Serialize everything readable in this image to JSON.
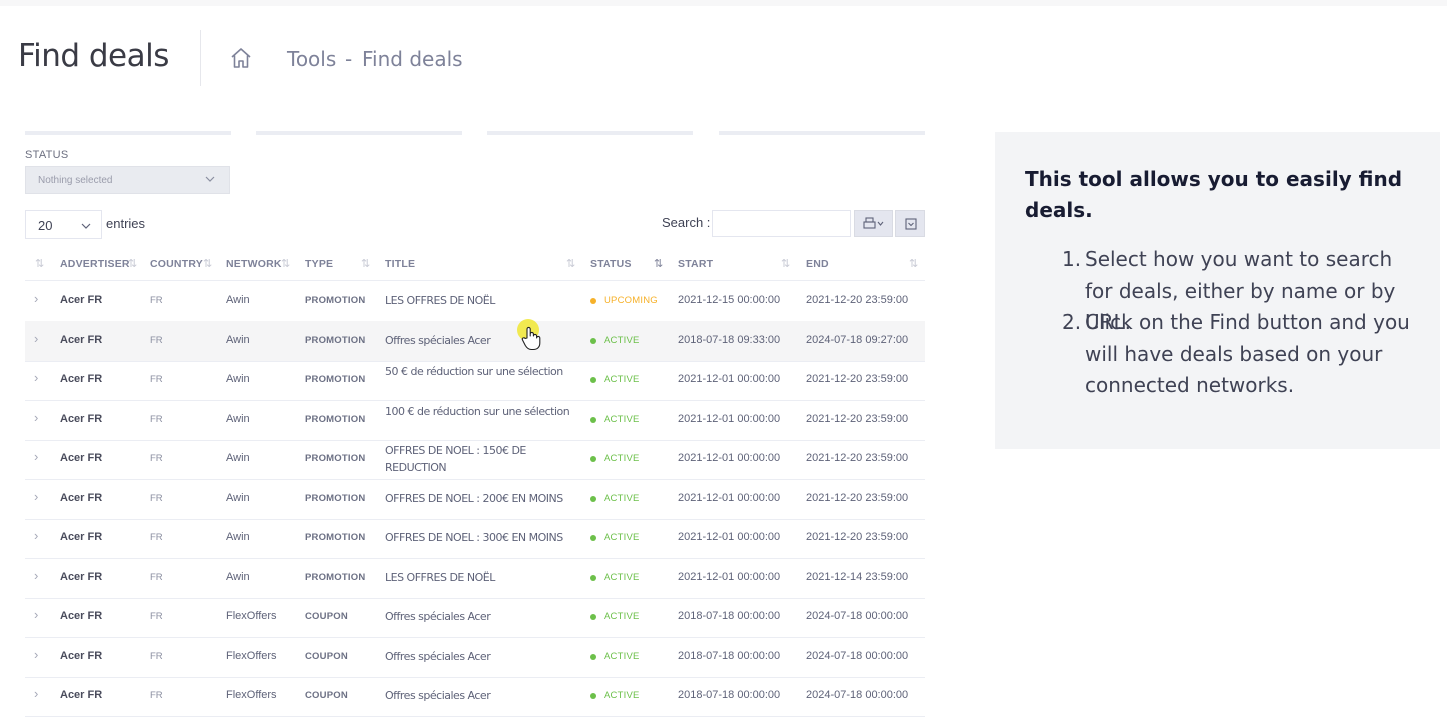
{
  "page_title": "Find deals",
  "breadcrumb": {
    "home_icon": "home-icon",
    "section": "Tools",
    "separator": "-",
    "current": "Find deals"
  },
  "filters": {
    "status_label": "STATUS",
    "status_placeholder": "Nothing selected"
  },
  "table_controls": {
    "page_length": "20",
    "entries_label": "entries",
    "search_label": "Search :",
    "search_value": "",
    "export_icon": "print-icon",
    "columns_icon": "columns-dropdown-icon"
  },
  "columns": [
    "ADVERTISER",
    "COUNTRY",
    "NETWORK",
    "TYPE",
    "TITLE",
    "STATUS",
    "START",
    "END"
  ],
  "rows": [
    {
      "advertiser": "Acer FR",
      "country": "FR",
      "network": "Awin",
      "type": "PROMOTION",
      "title": "LES OFFRES DE NOËL",
      "status": "UPCOMING",
      "start": "2021-12-15 00:00:00",
      "end": "2021-12-20 23:59:00"
    },
    {
      "advertiser": "Acer FR",
      "country": "FR",
      "network": "Awin",
      "type": "PROMOTION",
      "title": "Offres spéciales Acer",
      "status": "ACTIVE",
      "start": "2018-07-18 09:33:00",
      "end": "2024-07-18 09:27:00"
    },
    {
      "advertiser": "Acer FR",
      "country": "FR",
      "network": "Awin",
      "type": "PROMOTION",
      "title": "50 € de réduction sur une sélection",
      "status": "ACTIVE",
      "start": "2021-12-01 00:00:00",
      "end": "2021-12-20 23:59:00"
    },
    {
      "advertiser": "Acer FR",
      "country": "FR",
      "network": "Awin",
      "type": "PROMOTION",
      "title": "100 € de réduction sur une sélection",
      "status": "ACTIVE",
      "start": "2021-12-01 00:00:00",
      "end": "2021-12-20 23:59:00"
    },
    {
      "advertiser": "Acer FR",
      "country": "FR",
      "network": "Awin",
      "type": "PROMOTION",
      "title": "OFFRES DE NOEL : 150€ DE REDUCTION",
      "status": "ACTIVE",
      "start": "2021-12-01 00:00:00",
      "end": "2021-12-20 23:59:00"
    },
    {
      "advertiser": "Acer FR",
      "country": "FR",
      "network": "Awin",
      "type": "PROMOTION",
      "title": "OFFRES DE NOEL : 200€ EN MOINS",
      "status": "ACTIVE",
      "start": "2021-12-01 00:00:00",
      "end": "2021-12-20 23:59:00"
    },
    {
      "advertiser": "Acer FR",
      "country": "FR",
      "network": "Awin",
      "type": "PROMOTION",
      "title": "OFFRES DE NOEL : 300€ EN MOINS",
      "status": "ACTIVE",
      "start": "2021-12-01 00:00:00",
      "end": "2021-12-20 23:59:00"
    },
    {
      "advertiser": "Acer FR",
      "country": "FR",
      "network": "Awin",
      "type": "PROMOTION",
      "title": "LES OFFRES DE NOËL",
      "status": "ACTIVE",
      "start": "2021-12-01 00:00:00",
      "end": "2021-12-14 23:59:00"
    },
    {
      "advertiser": "Acer FR",
      "country": "FR",
      "network": "FlexOffers",
      "type": "COUPON",
      "title": "Offres spéciales Acer",
      "status": "ACTIVE",
      "start": "2018-07-18 00:00:00",
      "end": "2024-07-18 00:00:00"
    },
    {
      "advertiser": "Acer FR",
      "country": "FR",
      "network": "FlexOffers",
      "type": "COUPON",
      "title": "Offres spéciales Acer",
      "status": "ACTIVE",
      "start": "2018-07-18 00:00:00",
      "end": "2024-07-18 00:00:00"
    },
    {
      "advertiser": "Acer FR",
      "country": "FR",
      "network": "FlexOffers",
      "type": "COUPON",
      "title": "Offres spéciales Acer",
      "status": "ACTIVE",
      "start": "2018-07-18 00:00:00",
      "end": "2024-07-18 00:00:00"
    }
  ],
  "status_colors": {
    "UPCOMING": "#f6b12a",
    "ACTIVE": "#6cc04a"
  },
  "info_panel": {
    "heading": "This tool allows you to easily find deals.",
    "steps": [
      "Select how you want to search for deals, either by name or by URL.",
      "Click on the Find button and you will have deals based on your connected networks."
    ]
  }
}
